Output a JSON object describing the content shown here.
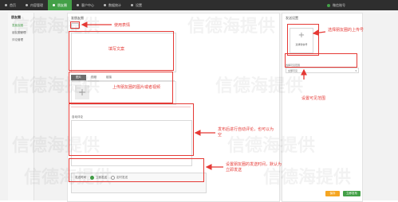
{
  "nav": {
    "items": [
      {
        "label": "首页"
      },
      {
        "label": "内容管理"
      },
      {
        "label": "朋友圈"
      },
      {
        "label": "客户中心"
      },
      {
        "label": "数据统计"
      },
      {
        "label": "设置"
      }
    ],
    "user": "微信账号"
  },
  "sidebar": {
    "title": "朋友圈",
    "items": [
      {
        "label": "发朋友圈"
      },
      {
        "label": "朋友圈管理"
      },
      {
        "label": "评论管理"
      }
    ]
  },
  "main": {
    "title": "发朋友圈",
    "tabs": [
      {
        "label": "图片"
      },
      {
        "label": "视频"
      },
      {
        "label": "链接"
      }
    ],
    "comment_label": "自动评论",
    "time_label": "发送时间",
    "time_options": [
      {
        "label": "立即发送"
      },
      {
        "label": "定时发送"
      }
    ]
  },
  "right": {
    "title": "发送设置",
    "upload_label": "选择微信号",
    "select_label": "选择可见范围",
    "select_value": "全部可见"
  },
  "buttons": {
    "save": "保存",
    "publish": "立即发布"
  },
  "annotations": {
    "use_emoji": "使用表情",
    "write_copy": "填写文案",
    "upload_media": "上传朋友圈的图片或者视频",
    "select_wechat": "选择朋友圈的上传号",
    "visible_range": "设置可见范围",
    "auto_comment": "发布后进行自动评论，也可以为空",
    "schedule": "设置朋友圈的发送时间，默认为立即发送"
  },
  "watermark": "信德海提供",
  "colors": {
    "annotation": "#e53935",
    "accent": "#43a047"
  }
}
